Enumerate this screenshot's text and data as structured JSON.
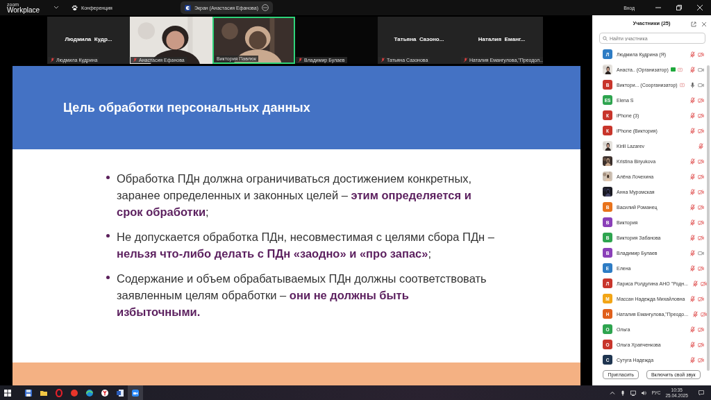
{
  "app": {
    "logo_top": "zoom",
    "logo_bottom": "Workplace",
    "menu": "Конференция",
    "share_pill": "Экран (Анастасия Ефанова)",
    "signin": "Вход"
  },
  "tiles": [
    {
      "kind": "name",
      "name": "Людмила  Кудр...",
      "label": "Людмила Кудрина",
      "muted": true,
      "speaking": false
    },
    {
      "kind": "picture",
      "label": "Анастасия Ефанова",
      "muted": true,
      "speaking": false
    },
    {
      "kind": "picture",
      "label": "Виктория Павлюк",
      "muted": false,
      "speaking": true
    },
    {
      "kind": "black",
      "label": "Владимир Булаев",
      "muted": true,
      "speaking": false
    },
    {
      "kind": "name",
      "name": "Татьяна  Сазоно...",
      "label": "Татьяна Сазонова",
      "muted": true,
      "speaking": false
    },
    {
      "kind": "name",
      "name": "Наталия  Еманг...",
      "label": "Наталия Емангулова,\"Преодол...",
      "muted": true,
      "speaking": false
    }
  ],
  "slide": {
    "title": "Цель обработки персональных данных",
    "bullets": [
      "Обработка ПДн должна ограничиваться достижением конкретных, заранее определенных и законных целей – **этим определяется и срок обработки**;",
      "Не допускается обработка ПДн, несовместимая с целями сбора ПДн – **нельзя что-либо делать с ПДн «заодно» и «про запас»**;",
      "Содержание и объем обрабатываемых ПДн должны соответствовать заявленным целям обработки – **они не должны быть избыточными.**"
    ]
  },
  "panel": {
    "title": "Участники (25)",
    "search": {
      "placeholder": "Найти участника"
    },
    "participants": [
      {
        "kind": "letter",
        "initial": "Л",
        "color": "#2d7cc4",
        "name": "Людмила Кудрина (Я)",
        "muted": true,
        "camera": true,
        "video_off": true
      },
      {
        "kind": "picture",
        "name": "Анаста..  (Организатор)",
        "badge": true,
        "share": true,
        "muted": true,
        "camera": true,
        "video_off": false
      },
      {
        "kind": "letter",
        "initial": "В",
        "color": "#c8352b",
        "name": "Виктори...  (Соорганизатор)",
        "badge": false,
        "share": true,
        "muted": false,
        "camera": true,
        "video_off": false
      },
      {
        "kind": "letter",
        "initial": "ES",
        "color": "#2ea44f",
        "name": "Elena S",
        "muted": true,
        "camera": true,
        "video_off": true
      },
      {
        "kind": "letter",
        "initial": "К",
        "color": "#c8352b",
        "name": "iPhone (3)",
        "muted": true,
        "camera": true,
        "video_off": true
      },
      {
        "kind": "letter",
        "initial": "К",
        "color": "#c8352b",
        "name": "iPhone (Виктория)",
        "muted": true,
        "camera": true,
        "video_off": true
      },
      {
        "kind": "picture",
        "name": "Kirill Lazarev",
        "muted": true,
        "camera": false
      },
      {
        "kind": "picture",
        "name": "Kristina Biryukova",
        "muted": true,
        "camera": true,
        "video_off": true
      },
      {
        "kind": "picture",
        "name": "Алёна Лочехина",
        "muted": true,
        "camera": true,
        "video_off": true
      },
      {
        "kind": "picture",
        "name": "Анна Муромская",
        "muted": true,
        "camera": true,
        "video_off": true
      },
      {
        "kind": "letter",
        "initial": "В",
        "color": "#e8731c",
        "name": "Василий Романец",
        "muted": true,
        "camera": true,
        "video_off": true
      },
      {
        "kind": "letter",
        "initial": "В",
        "color": "#8a3fb8",
        "name": "Виктория",
        "muted": true,
        "camera": true,
        "video_off": true
      },
      {
        "kind": "letter",
        "initial": "В",
        "color": "#2ea44f",
        "name": "Виктория Забанова",
        "muted": true,
        "camera": true,
        "video_off": true
      },
      {
        "kind": "letter",
        "initial": "В",
        "color": "#8a3fb8",
        "name": "Владимир Булаев",
        "muted": true,
        "camera": true,
        "video_off": false
      },
      {
        "kind": "letter",
        "initial": "Е",
        "color": "#2d7cc4",
        "name": "Елена",
        "muted": true,
        "camera": true,
        "video_off": true
      },
      {
        "kind": "letter",
        "initial": "Л",
        "color": "#c8352b",
        "name": "Лариса Ролдугина АНО \"Родн...",
        "muted": true,
        "camera": true,
        "video_off": true
      },
      {
        "kind": "letter",
        "initial": "М",
        "color": "#f2a516",
        "name": "Массан Надежда Михайловна",
        "muted": true,
        "camera": true,
        "video_off": true
      },
      {
        "kind": "letter",
        "initial": "Н",
        "color": "#e0601c",
        "name": "Наталия Емангулова,\"Преодо...",
        "muted": true,
        "camera": true,
        "video_off": true
      },
      {
        "kind": "letter",
        "initial": "О",
        "color": "#2ea44f",
        "name": "Ольга",
        "muted": true,
        "camera": true,
        "video_off": true
      },
      {
        "kind": "letter",
        "initial": "О",
        "color": "#c8352b",
        "name": "Ольга Храпченкова",
        "muted": true,
        "camera": true,
        "video_off": true
      },
      {
        "kind": "letter",
        "initial": "С",
        "color": "#1f3550",
        "name": "Сутуга Надежда",
        "muted": true,
        "camera": true,
        "video_off": true
      }
    ],
    "buttons": [
      "Пригласить",
      "Включить свой звук"
    ]
  },
  "taskbar": {
    "language": "РУС",
    "time": "10:35",
    "date": "25.04.2025"
  }
}
